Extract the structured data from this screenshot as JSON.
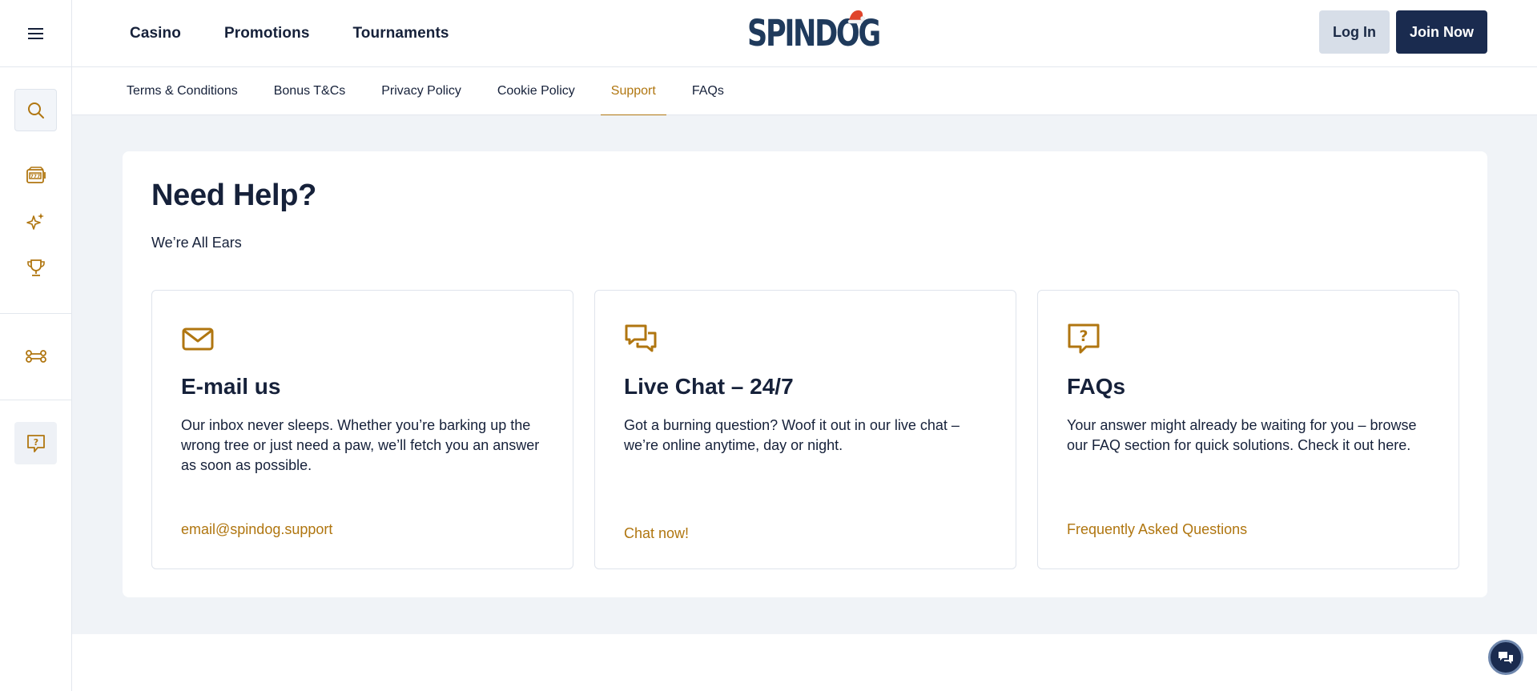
{
  "colors": {
    "accent": "#b07610",
    "navy": "#1a2b4f",
    "background": "#f0f3f7",
    "text": "#16213a"
  },
  "rail": {
    "icons": [
      "menu-icon",
      "search-icon",
      "slot-machine-icon",
      "sparkles-icon",
      "trophy-icon",
      "bone-icon",
      "help-question-icon"
    ]
  },
  "header": {
    "nav": [
      "Casino",
      "Promotions",
      "Tournaments"
    ],
    "logo_text": "SPINDOG",
    "login_label": "Log In",
    "join_label": "Join Now"
  },
  "subnav": {
    "tabs": [
      "Terms & Conditions",
      "Bonus T&Cs",
      "Privacy Policy",
      "Cookie Policy",
      "Support",
      "FAQs"
    ],
    "active": "Support"
  },
  "main": {
    "title": "Need Help?",
    "subtitle": "We’re All Ears",
    "cards": [
      {
        "icon": "envelope-icon",
        "title": "E-mail us",
        "text": "Our inbox never sleeps. Whether you’re barking up the wrong tree or just need a paw, we’ll fetch you an answer as soon as possible.",
        "link": "email@spindog.support"
      },
      {
        "icon": "chat-bubbles-icon",
        "title": "Live Chat – 24/7",
        "text": "Got a burning question? Woof it out in our live chat – we’re online anytime, day or night.",
        "link": "Chat now!"
      },
      {
        "icon": "question-bubble-icon",
        "title": "FAQs",
        "text": "Your answer might already be waiting for you – browse our FAQ section for quick solutions. Check it out here.",
        "link": "Frequently Asked Questions"
      }
    ]
  }
}
